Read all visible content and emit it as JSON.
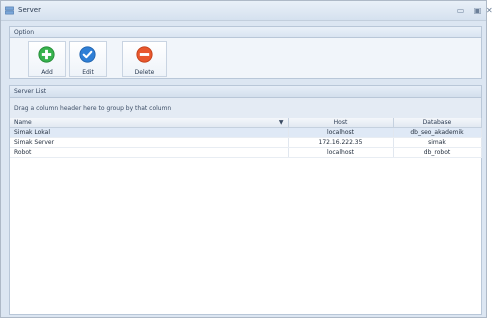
{
  "window": {
    "title": "Server",
    "minimize_glyph": "▭",
    "maximize_glyph": "▣",
    "close_glyph": "✕"
  },
  "ribbon": {
    "tab_label": "Option",
    "buttons": [
      {
        "label": "Add",
        "icon": "plus-circle-icon",
        "color": "#37b24d"
      },
      {
        "label": "Edit",
        "icon": "check-circle-icon",
        "color": "#2f7fd6"
      },
      {
        "label": "Delete",
        "icon": "minus-circle-icon",
        "color": "#e8572d"
      }
    ]
  },
  "server_list": {
    "panel_title": "Server List",
    "group_hint": "Drag a column header here to group by that column",
    "columns": [
      "Name",
      "Host",
      "Database"
    ],
    "rows": [
      {
        "name": "Simak Lokal",
        "host": "localhost",
        "database": "db_seo_akademik"
      },
      {
        "name": "Simak Server",
        "host": "172.16.222.35",
        "database": "simak"
      },
      {
        "name": "Robot",
        "host": "localhost",
        "database": "db_robot"
      }
    ]
  }
}
